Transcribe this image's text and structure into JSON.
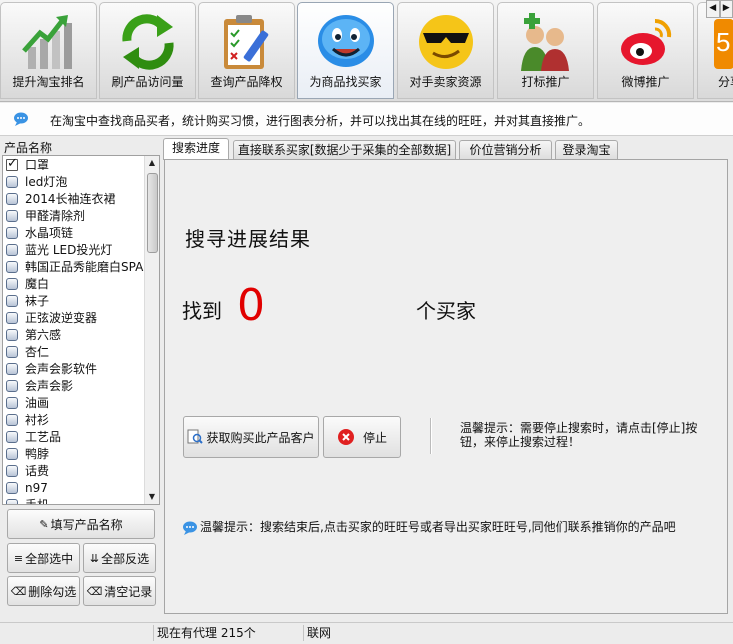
{
  "toolbar": {
    "items": [
      {
        "label": "提升淘宝排名",
        "icon": "bar-chart-icon"
      },
      {
        "label": "刷产品访问量",
        "icon": "refresh-arrows-icon"
      },
      {
        "label": "查询产品降权",
        "icon": "clipboard-check-icon"
      },
      {
        "label": "为商品找买家",
        "icon": "smiley-bubble-icon"
      },
      {
        "label": "对手卖家资源",
        "icon": "cool-face-icon"
      },
      {
        "label": "打标推广",
        "icon": "people-plus-icon"
      },
      {
        "label": "微博推广",
        "icon": "weibo-icon"
      },
      {
        "label": "分享",
        "icon": "share-icon"
      }
    ],
    "scroll_left": "◀",
    "scroll_right": "▶"
  },
  "info": {
    "text": "在淘宝中查找商品买者，统计购买习惯，进行图表分析，并可以找出其在线的旺旺，并对其直接推广。"
  },
  "sidebar": {
    "header": "产品名称",
    "items": [
      {
        "label": "口罩",
        "checked": true
      },
      {
        "label": "led灯泡",
        "checked": false
      },
      {
        "label": "2014长袖连衣裙",
        "checked": false
      },
      {
        "label": "甲醛清除剂",
        "checked": false
      },
      {
        "label": "水晶项链",
        "checked": false
      },
      {
        "label": "蓝光 LED投光灯",
        "checked": false
      },
      {
        "label": "韩国正品秀能磨白SPA",
        "checked": false
      },
      {
        "label": "魔白",
        "checked": false
      },
      {
        "label": "袜子",
        "checked": false
      },
      {
        "label": "正弦波逆变器",
        "checked": false
      },
      {
        "label": "第六感",
        "checked": false
      },
      {
        "label": "杏仁",
        "checked": false
      },
      {
        "label": "会声会影软件",
        "checked": false
      },
      {
        "label": "会声会影",
        "checked": false
      },
      {
        "label": "油画",
        "checked": false
      },
      {
        "label": "衬衫",
        "checked": false
      },
      {
        "label": "工艺品",
        "checked": false
      },
      {
        "label": "鸭脖",
        "checked": false
      },
      {
        "label": "话费",
        "checked": false
      },
      {
        "label": "n97",
        "checked": false
      },
      {
        "label": "手机",
        "checked": false
      }
    ],
    "buttons": {
      "fill_name": "填写产品名称",
      "select_all": "全部选中",
      "invert": "全部反选",
      "delete_checked": "删除勾选",
      "clear": "清空记录"
    }
  },
  "tabs": [
    "搜索进度",
    "直接联系买家[数据少于采集的全部数据]",
    "价位营销分析",
    "登录淘宝"
  ],
  "panel": {
    "title": "搜寻进展结果",
    "found_label": "找到",
    "count": "0",
    "unit": "个买家",
    "get_button": "获取购买此产品客户",
    "stop_button": "停止",
    "tip_stop": "温馨提示：需要停止搜索时，请点击[停止]按钮，来停止搜索过程！",
    "tip_contact": "温馨提示：搜索结束后,点击买家的旺旺号或者导出买家旺旺号,同他们联系推销你的产品吧"
  },
  "status": {
    "proxy": "现在有代理 215个",
    "network": "联网"
  },
  "colors": {
    "count": "#e10000",
    "accent": "#1d7bd6"
  }
}
